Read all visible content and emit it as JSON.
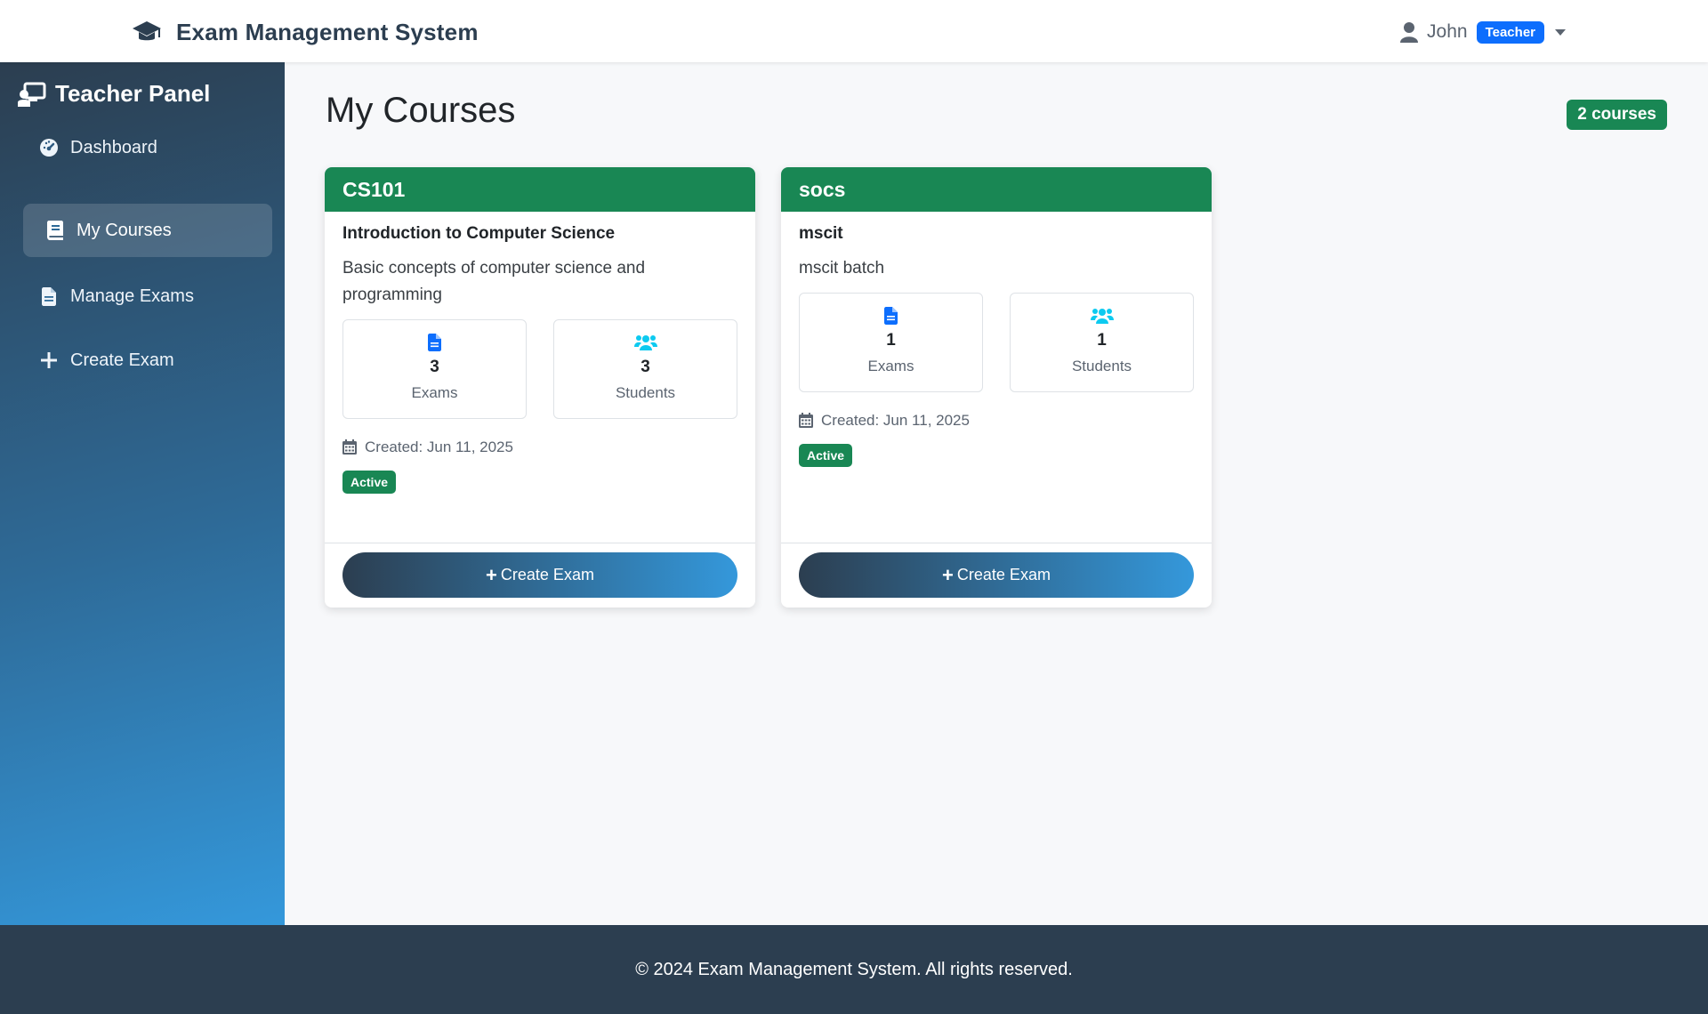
{
  "navbar": {
    "brand_icon": "graduation-cap-icon",
    "brand": "Exam Management System",
    "user_name": "John",
    "role_badge": "Teacher"
  },
  "sidebar": {
    "title": "Teacher Panel",
    "items": [
      {
        "label": "Dashboard",
        "icon": "gauge-icon",
        "active": false
      },
      {
        "label": "My Courses",
        "icon": "book-icon",
        "active": true
      },
      {
        "label": "Manage Exams",
        "icon": "file-icon",
        "active": false
      },
      {
        "label": "Create Exam",
        "icon": "plus-icon",
        "active": false
      }
    ]
  },
  "main": {
    "title": "My Courses",
    "count_badge": "2 courses"
  },
  "courses": [
    {
      "code": "CS101",
      "name": "Introduction to Computer Science",
      "description": "Basic concepts of computer science and programming",
      "exams_count": "3",
      "exams_label": "Exams",
      "students_count": "3",
      "students_label": "Students",
      "created": "Created: Jun 11, 2025",
      "status": "Active",
      "button": "Create Exam"
    },
    {
      "code": "socs",
      "name": "mscit",
      "description": "mscit batch",
      "exams_count": "1",
      "exams_label": "Exams",
      "students_count": "1",
      "students_label": "Students",
      "created": "Created: Jun 11, 2025",
      "status": "Active",
      "button": "Create Exam"
    }
  ],
  "footer": {
    "text": "© 2024 Exam Management System. All rights reserved."
  },
  "colors": {
    "primary_dark": "#2c3e50",
    "primary_light": "#3498db",
    "success": "#198754",
    "info_blue": "#0d6efd",
    "cyan": "#0dcaf0"
  }
}
